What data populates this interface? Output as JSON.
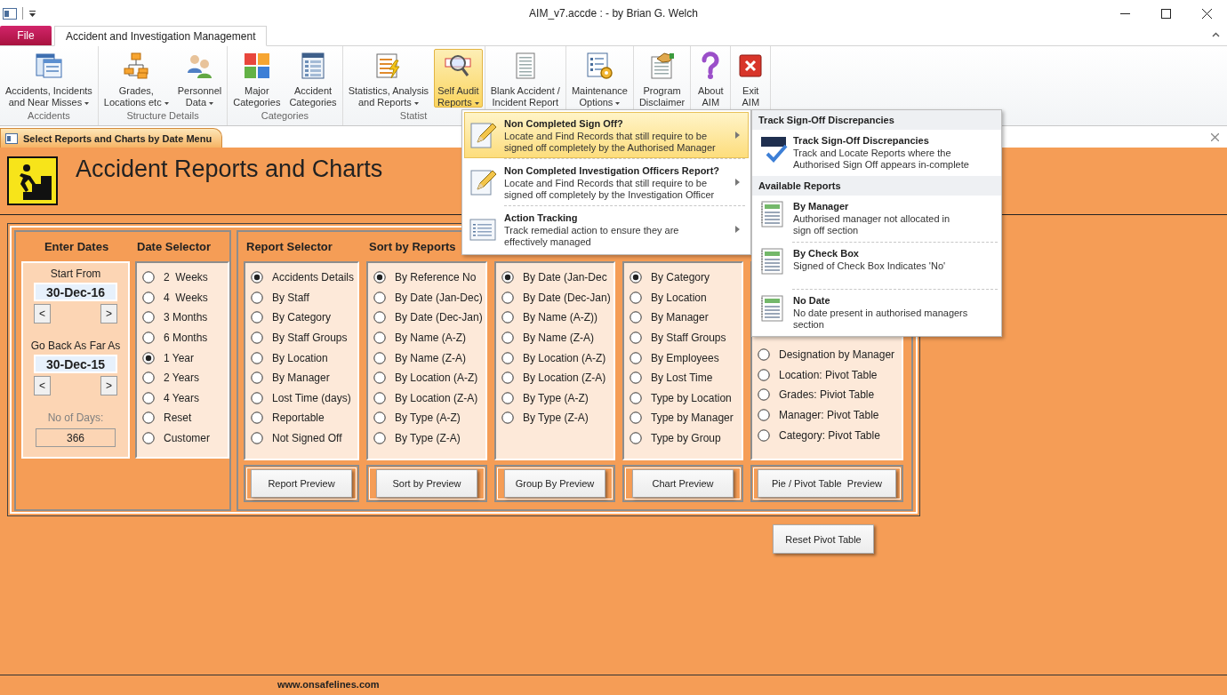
{
  "window": {
    "title": "AIM_v7.accde :  - by Brian G. Welch"
  },
  "ribbon_tabs": [
    {
      "label": "File",
      "kind": "file",
      "selected": false
    },
    {
      "label": "Accident and Investigation Management",
      "kind": "tab",
      "selected": true
    }
  ],
  "ribbon_groups": [
    {
      "label": "Accidents",
      "buttons": [
        {
          "lines": [
            "Accidents, Incidents",
            "and Near Misses"
          ],
          "dropdown": true,
          "selected": false
        }
      ]
    },
    {
      "label": "Structure Details",
      "buttons": [
        {
          "lines": [
            "Grades,",
            "Locations etc"
          ],
          "dropdown": true,
          "selected": false
        },
        {
          "lines": [
            "Personnel",
            "Data"
          ],
          "dropdown": true,
          "selected": false
        }
      ]
    },
    {
      "label": "Categories",
      "buttons": [
        {
          "lines": [
            "Major",
            "Categories"
          ],
          "dropdown": false,
          "selected": false
        },
        {
          "lines": [
            "Accident",
            "Categories"
          ],
          "dropdown": false,
          "selected": false
        }
      ]
    },
    {
      "label": "Statist",
      "buttons": [
        {
          "lines": [
            "Statistics, Analysis",
            "and Reports"
          ],
          "dropdown": true,
          "selected": false
        },
        {
          "lines": [
            "Self Audit",
            "Reports"
          ],
          "dropdown": true,
          "selected": true
        }
      ]
    },
    {
      "buttons": [
        {
          "lines": [
            "Blank Accident /",
            "Incident Report"
          ],
          "dropdown": false,
          "selected": false
        }
      ]
    },
    {
      "buttons": [
        {
          "lines": [
            "Maintenance",
            "Options"
          ],
          "dropdown": true,
          "selected": false
        }
      ]
    },
    {
      "buttons": [
        {
          "lines": [
            "Program",
            "Disclaimer"
          ],
          "dropdown": false,
          "selected": false
        }
      ]
    },
    {
      "buttons": [
        {
          "lines": [
            "About",
            "AIM"
          ],
          "dropdown": false,
          "selected": false
        }
      ]
    },
    {
      "buttons": [
        {
          "lines": [
            "Exit",
            "AIM"
          ],
          "dropdown": false,
          "selected": false
        }
      ]
    }
  ],
  "document_tab": {
    "title": "Select Reports and Charts by Date Menu"
  },
  "form": {
    "title": "Accident Reports and Charts",
    "dates": {
      "heading": "Enter Dates",
      "start_label": "Start From",
      "start_value": "30-Dec-16",
      "start_buttons": [
        "<",
        ">"
      ],
      "back_label": "Go Back As Far As",
      "back_value": "30-Dec-15",
      "back_buttons": [
        "<",
        ">"
      ],
      "days_label": "No of Days:",
      "days_value": "366"
    },
    "date_selector": {
      "heading": "Date Selector",
      "options": [
        {
          "label": "2  Weeks",
          "selected": false
        },
        {
          "label": "4  Weeks",
          "selected": false
        },
        {
          "label": "3 Months",
          "selected": false
        },
        {
          "label": "6 Months",
          "selected": false
        },
        {
          "label": "1 Year",
          "selected": true
        },
        {
          "label": "2 Years",
          "selected": false
        },
        {
          "label": "4 Years",
          "selected": false
        },
        {
          "label": "Reset",
          "selected": false
        },
        {
          "label": "Customer",
          "selected": false
        }
      ]
    },
    "report_columns": [
      {
        "heading": "Report Selector",
        "button": "Report Preview",
        "options": [
          {
            "label": "Accidents Details",
            "selected": true
          },
          {
            "label": "By Staff",
            "selected": false
          },
          {
            "label": "By Category",
            "selected": false
          },
          {
            "label": "By Staff Groups",
            "selected": false
          },
          {
            "label": "By Location",
            "selected": false
          },
          {
            "label": "By Manager",
            "selected": false
          },
          {
            "label": "Lost Time (days)",
            "selected": false
          },
          {
            "label": "Reportable",
            "selected": false
          },
          {
            "label": "Not Signed Off",
            "selected": false
          }
        ]
      },
      {
        "heading": "Sort by Reports",
        "button": "Sort by Preview",
        "options": [
          {
            "label": "By Reference No",
            "selected": true
          },
          {
            "label": "By Date (Jan-Dec)",
            "selected": false
          },
          {
            "label": "By Date (Dec-Jan)",
            "selected": false
          },
          {
            "label": "By Name (A-Z)",
            "selected": false
          },
          {
            "label": "By Name (Z-A)",
            "selected": false
          },
          {
            "label": "By Location (A-Z)",
            "selected": false
          },
          {
            "label": "By Location (Z-A)",
            "selected": false
          },
          {
            "label": "By Type (A-Z)",
            "selected": false
          },
          {
            "label": "By Type (Z-A)",
            "selected": false
          }
        ]
      },
      {
        "button": "Group By Preview",
        "options": [
          {
            "label": "By Date (Jan-Dec",
            "selected": true
          },
          {
            "label": "By Date (Dec-Jan)",
            "selected": false
          },
          {
            "label": "By Name (A-Z))",
            "selected": false
          },
          {
            "label": "By Name (Z-A)",
            "selected": false
          },
          {
            "label": "By Location (A-Z)",
            "selected": false
          },
          {
            "label": "By Location (Z-A)",
            "selected": false
          },
          {
            "label": "By Type (A-Z)",
            "selected": false
          },
          {
            "label": "By Type (Z-A)",
            "selected": false
          }
        ]
      },
      {
        "button": "Chart Preview",
        "options": [
          {
            "label": "By Category",
            "selected": true
          },
          {
            "label": "By Location",
            "selected": false
          },
          {
            "label": "By Manager",
            "selected": false
          },
          {
            "label": "By Staff Groups",
            "selected": false
          },
          {
            "label": "By Employees",
            "selected": false
          },
          {
            "label": "By Lost Time",
            "selected": false
          },
          {
            "label": "Type by Location",
            "selected": false
          },
          {
            "label": "Type by Manager",
            "selected": false
          },
          {
            "label": "Type by Group",
            "selected": false
          }
        ]
      },
      {
        "button": "Pie / Pivot Table  Preview",
        "options": [
          {
            "label": "Designation by Manager",
            "selected": false
          },
          {
            "label": "Location: Pivot Table",
            "selected": false
          },
          {
            "label": "Grades: Piviot Table",
            "selected": false
          },
          {
            "label": "Manager: Pivot Table",
            "selected": false
          },
          {
            "label": "Category: Pivot Table",
            "selected": false
          }
        ]
      }
    ],
    "reset_button": "Reset Pivot Table",
    "footer": "www.onsafelines.com"
  },
  "menu": {
    "items": [
      {
        "title": "Non Completed Sign Off?",
        "description": [
          "Locate and Find Records that still require to be",
          "signed off completely by the Authorised Manager"
        ],
        "selected": true,
        "submenu": true
      },
      {
        "title": "Non Completed Investigation Officers Report?",
        "description": [
          "Locate and Find Records that still require to be",
          "signed off completely by the Investigation Officer"
        ],
        "selected": false,
        "submenu": true
      },
      {
        "title": "Action Tracking",
        "description": [
          "Track remedial action to ensure they are",
          "effectively managed"
        ],
        "selected": false,
        "submenu": true
      }
    ]
  },
  "submenu": {
    "sections": [
      {
        "heading": "Track Sign-Off Discrepancies",
        "items": [
          {
            "title": "Track Sign-Off Discrepancies",
            "description": [
              "Track and Locate Reports where the",
              "Authorised Sign Off appears in-complete"
            ]
          }
        ]
      },
      {
        "heading": "Available Reports",
        "items": [
          {
            "title": "By Manager",
            "description": [
              "Authorised manager not allocated in",
              "sign off section"
            ]
          },
          {
            "title": "By Check Box",
            "description": [
              "Signed of Check Box Indicates 'No'"
            ]
          },
          {
            "title": "No Date",
            "description": [
              "No date present in authorised managers",
              "section"
            ]
          }
        ]
      }
    ]
  }
}
